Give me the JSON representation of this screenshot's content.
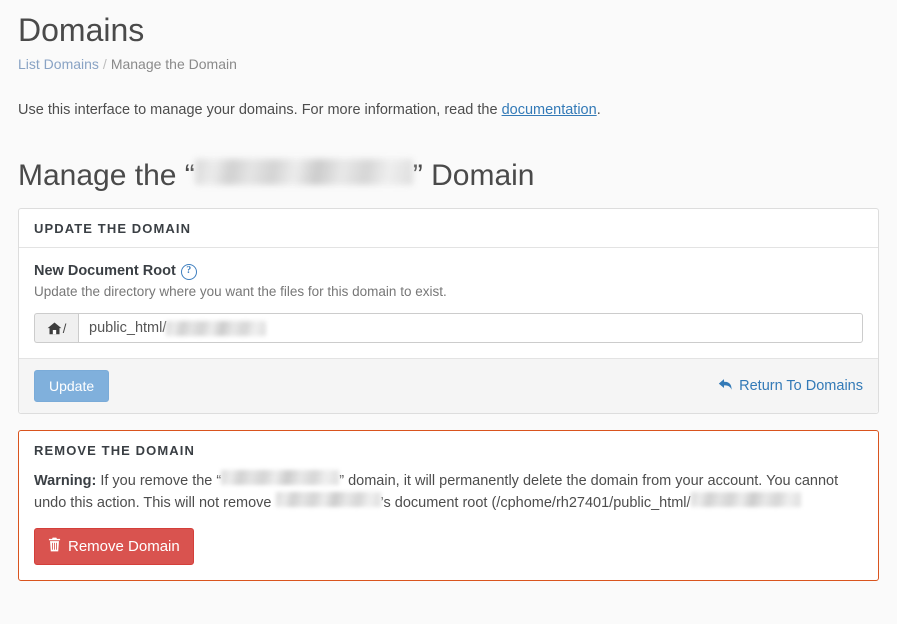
{
  "header": {
    "title": "Domains",
    "breadcrumb": {
      "root_label": "List Domains",
      "separator": "/",
      "current_label": "Manage the Domain"
    },
    "intro_before": "Use this interface to manage your domains. For more information, read the ",
    "intro_link": "documentation",
    "intro_after": "."
  },
  "manage_heading": {
    "prefix": "Manage the “",
    "domain_name": "",
    "suffix": "” Domain"
  },
  "update_panel": {
    "heading": "UPDATE THE DOMAIN",
    "field_label": "New Document Root",
    "help_icon_glyph": "?",
    "help_icon_name": "question-circle-icon",
    "field_help": "Update the directory where you want the files for this domain to exist.",
    "addon_icon_name": "home-icon",
    "addon_slash": "/",
    "input_value_prefix": "public_html/",
    "input_value_domain": "",
    "update_button_label": "Update",
    "update_button_disabled": true,
    "return_link_label": "Return To Domains",
    "return_link_icon_name": "reply-arrow-icon"
  },
  "remove_panel": {
    "heading": "REMOVE THE DOMAIN",
    "warning_label": "Warning:",
    "warning_part1": " If you remove the “",
    "warning_redacted_domain_1": "",
    "warning_part2": "” domain, it will permanently delete the domain from your account. You cannot undo this action. This will not remove ",
    "warning_redacted_domain_2": "",
    "warning_part3": "’s document root (/cphome/rh27401/public_html/",
    "warning_redacted_domain_3": "",
    "remove_button_label": "Remove Domain",
    "remove_button_icon_name": "trash-icon"
  },
  "colors": {
    "page_background": "#fafafa",
    "panel_border": "#dddddd",
    "danger_border": "#d9541e",
    "link_blue": "#337ab7",
    "primary_disabled_blue": "#80b0dc",
    "danger_red": "#d9534f",
    "heading_text": "#3a3f44",
    "body_text": "#4d4d4d",
    "muted_text": "#777777"
  }
}
